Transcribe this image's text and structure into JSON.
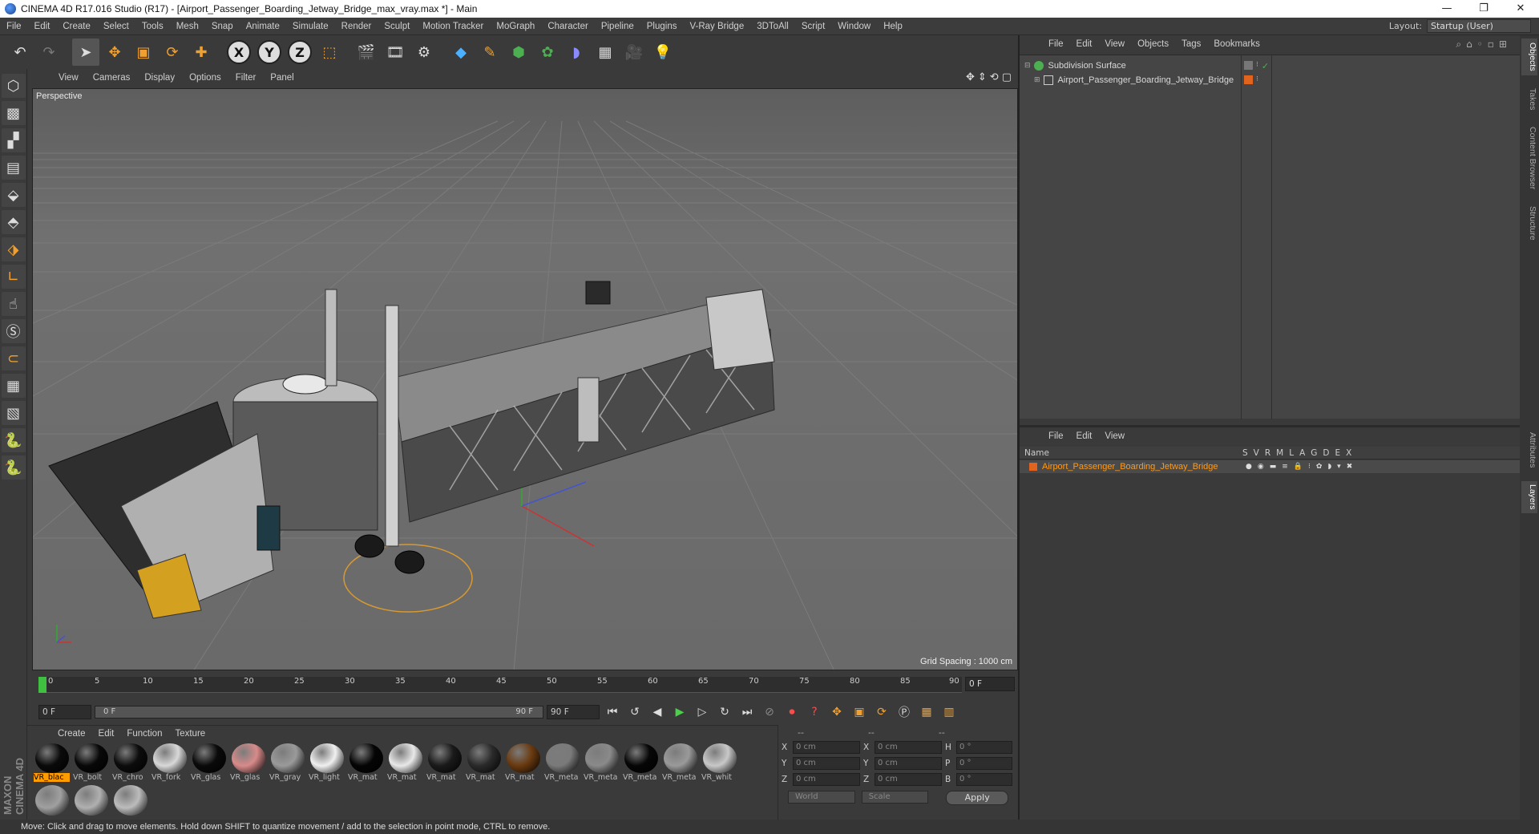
{
  "window": {
    "title": "CINEMA 4D R17.016 Studio (R17) - [Airport_Passenger_Boarding_Jetway_Bridge_max_vray.max *] - Main",
    "minimize": "—",
    "maximize": "❐",
    "close": "✕"
  },
  "menubar": {
    "items": [
      "File",
      "Edit",
      "Create",
      "Select",
      "Tools",
      "Mesh",
      "Snap",
      "Animate",
      "Simulate",
      "Render",
      "Sculpt",
      "Motion Tracker",
      "MoGraph",
      "Character",
      "Pipeline",
      "Plugins",
      "V-Ray Bridge",
      "3DToAll",
      "Script",
      "Window",
      "Help"
    ],
    "layout_label": "Layout:",
    "layout_value": "Startup (User)"
  },
  "toolbar": {
    "axis_x": "X",
    "axis_y": "Y",
    "axis_z": "Z"
  },
  "viewport": {
    "menu": [
      "View",
      "Cameras",
      "Display",
      "Options",
      "Filter",
      "Panel"
    ],
    "label": "Perspective",
    "grid_spacing": "Grid Spacing : 1000 cm"
  },
  "timeline": {
    "ticks": [
      "0",
      "5",
      "10",
      "15",
      "20",
      "25",
      "30",
      "35",
      "40",
      "45",
      "50",
      "55",
      "60",
      "65",
      "70",
      "75",
      "80",
      "85",
      "90"
    ],
    "frame_end": "0 F",
    "start_field": "0 F",
    "slider_start": "0 F",
    "slider_end": "90 F",
    "end_field": "90 F"
  },
  "materials": {
    "menu": [
      "Create",
      "Edit",
      "Function",
      "Texture"
    ],
    "items": [
      {
        "name": "VR_blac",
        "color": "#0a0a0a",
        "selected": true
      },
      {
        "name": "VR_bolt",
        "color": "#080808"
      },
      {
        "name": "VR_chro",
        "color": "#0c0c0c"
      },
      {
        "name": "VR_fork",
        "color": "#d8d8d8"
      },
      {
        "name": "VR_glas",
        "color": "#0a0a0a"
      },
      {
        "name": "VR_glas",
        "color": "#d88a8a"
      },
      {
        "name": "VR_gray",
        "color": "#9a9a9a"
      },
      {
        "name": "VR_light",
        "color": "#f0f0f0"
      },
      {
        "name": "VR_mat",
        "color": "#050505"
      },
      {
        "name": "VR_mat",
        "color": "#e8e8e8"
      },
      {
        "name": "VR_mat",
        "color": "#1a1a1a"
      },
      {
        "name": "VR_mat",
        "color": "#2a2a2a"
      },
      {
        "name": "VR_mat",
        "color": "#6a3a10"
      },
      {
        "name": "VR_meta",
        "color": "#7a7a7a"
      },
      {
        "name": "VR_meta",
        "color": "#8a8a8a"
      },
      {
        "name": "VR_meta",
        "color": "#060606"
      },
      {
        "name": "VR_meta",
        "color": "#9a9a9a"
      },
      {
        "name": "VR_whit",
        "color": "#c8c8c8"
      },
      {
        "name": "",
        "color": "#a0a0a0"
      },
      {
        "name": "",
        "color": "#b0b0b0"
      },
      {
        "name": "",
        "color": "#bcbcbc"
      }
    ]
  },
  "coordinates": {
    "head": [
      "--",
      "--",
      "--"
    ],
    "rows": [
      {
        "a": "X",
        "av": "0 cm",
        "b": "X",
        "bv": "0 cm",
        "c": "H",
        "cv": "0 °"
      },
      {
        "a": "Y",
        "av": "0 cm",
        "b": "Y",
        "bv": "0 cm",
        "c": "P",
        "cv": "0 °"
      },
      {
        "a": "Z",
        "av": "0 cm",
        "b": "Z",
        "bv": "0 cm",
        "c": "B",
        "cv": "0 °"
      }
    ],
    "mode": "World",
    "transform": "Scale",
    "apply": "Apply"
  },
  "objects": {
    "menu": [
      "File",
      "Edit",
      "View",
      "Objects",
      "Tags",
      "Bookmarks"
    ],
    "rows": [
      {
        "label": "Subdivision Surface",
        "icon": "subdivision-icon",
        "icon_color": "#4caf50"
      },
      {
        "label": "Airport_Passenger_Boarding_Jetway_Bridge",
        "icon": "null-object-icon",
        "icon_color": "#c8c8c8",
        "tag_color": "#e0641e"
      }
    ]
  },
  "layers": {
    "menu": [
      "File",
      "Edit",
      "View"
    ],
    "columns": [
      "Name",
      "S",
      "V",
      "R",
      "M",
      "L",
      "A",
      "G",
      "D",
      "E",
      "X"
    ],
    "row": {
      "name": "Airport_Passenger_Boarding_Jetway_Bridge",
      "color": "#e0641e"
    }
  },
  "side_tabs": [
    "Objects",
    "Takes",
    "Content Browser",
    "Structure",
    "Attributes",
    "Layers"
  ],
  "brand": "MAXON CINEMA 4D",
  "status": "Move: Click and drag to move elements. Hold down SHIFT to quantize movement / add to the selection in point mode, CTRL to remove."
}
